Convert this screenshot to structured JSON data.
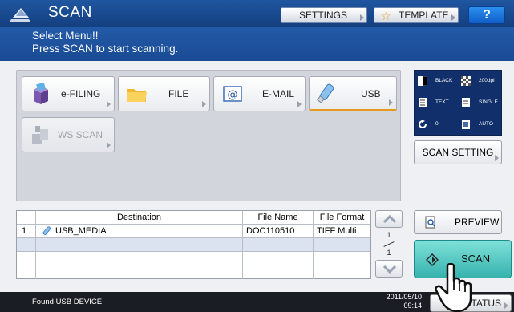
{
  "header": {
    "title": "SCAN",
    "settings_label": "SETTINGS",
    "template_label": "TEMPLATE",
    "help_label": "?"
  },
  "message": {
    "line1": "Select Menu!!",
    "line2": "Press SCAN to start scanning."
  },
  "agents": [
    {
      "label": "e-FILING",
      "icon": "efiling-icon",
      "state": "normal"
    },
    {
      "label": "FILE",
      "icon": "folder-icon",
      "state": "normal"
    },
    {
      "label": "E-MAIL",
      "icon": "email-icon",
      "state": "normal"
    },
    {
      "label": "USB",
      "icon": "usb-icon",
      "state": "selected"
    },
    {
      "label": "WS SCAN",
      "icon": "ws-scan-icon",
      "state": "disabled"
    }
  ],
  "scan_summary": {
    "color_mode": "BLACK",
    "resolution": "200dpi",
    "original_mode": "TEXT",
    "sides": "SINGLE",
    "rotation": "0",
    "size": "AUTO"
  },
  "scan_setting_label": "SCAN SETTING",
  "destination_table": {
    "headers": [
      "",
      "Destination",
      "File Name",
      "File Format"
    ],
    "rows": [
      {
        "index": "1",
        "destination": "USB_MEDIA",
        "file_name": "DOC110510",
        "file_format": "TIFF Multi"
      }
    ]
  },
  "pager": {
    "current": "1",
    "total": "1"
  },
  "preview_label": "PREVIEW",
  "scan_label": "SCAN",
  "status": {
    "message": "Found USB DEVICE.",
    "date": "2011/05/10",
    "time": "09:14",
    "job_status_label": "JOB STATUS"
  },
  "colors": {
    "header_blue": "#1f56a0",
    "scan_button": "#36b3ae",
    "selected_underline": "#e49a1a",
    "help_blue": "#1a72db"
  }
}
